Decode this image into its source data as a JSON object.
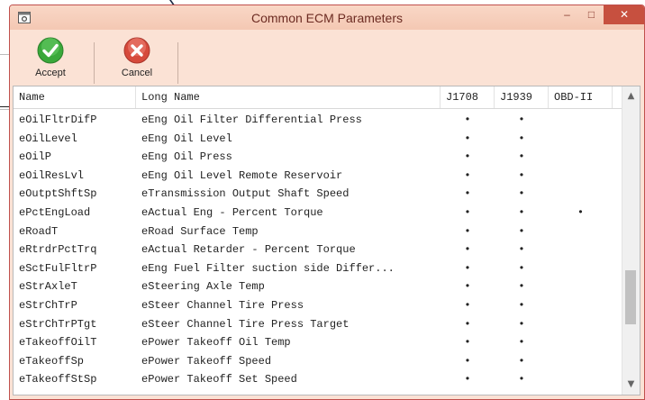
{
  "window": {
    "title": "Common ECM Parameters"
  },
  "controls": {
    "minimize": "–",
    "maximize": "□",
    "close": "✕"
  },
  "toolbar": {
    "accept_label": "Accept",
    "cancel_label": "Cancel"
  },
  "icons": {
    "app": "window-settings-icon",
    "accept": "green-checkmark-icon",
    "cancel": "red-x-icon",
    "scroll_up": "chevron-up-icon",
    "scroll_down": "chevron-down-icon"
  },
  "colors": {
    "title_bar": "#f7cfbc",
    "close_button": "#c7503f",
    "accept": "#3aa83a",
    "cancel": "#d64a3c"
  },
  "table": {
    "columns": [
      "Name",
      "Long Name",
      "J1708",
      "J1939",
      "OBD-II"
    ],
    "rows": [
      [
        "eOilFltrDifP",
        "eEng Oil Filter Differential Press",
        "•",
        "•",
        ""
      ],
      [
        "eOilLevel",
        "eEng Oil Level",
        "•",
        "•",
        ""
      ],
      [
        "eOilP",
        "eEng Oil Press",
        "•",
        "•",
        ""
      ],
      [
        "eOilResLvl",
        "eEng Oil Level Remote Reservoir",
        "•",
        "•",
        ""
      ],
      [
        "eOutptShftSp",
        "eTransmission Output Shaft Speed",
        "•",
        "•",
        ""
      ],
      [
        "ePctEngLoad",
        "eActual Eng - Percent Torque",
        "•",
        "•",
        "•"
      ],
      [
        "eRoadT",
        "eRoad Surface Temp",
        "•",
        "•",
        ""
      ],
      [
        "eRtrdrPctTrq",
        "eActual Retarder - Percent Torque",
        "•",
        "•",
        ""
      ],
      [
        "eSctFulFltrP",
        "eEng Fuel Filter suction side Differ...",
        "•",
        "•",
        ""
      ],
      [
        "eStrAxleT",
        "eSteering Axle Temp",
        "•",
        "•",
        ""
      ],
      [
        "eStrChTrP",
        "eSteer Channel Tire Press",
        "•",
        "•",
        ""
      ],
      [
        "eStrChTrPTgt",
        "eSteer Channel Tire Press Target",
        "•",
        "•",
        ""
      ],
      [
        "eTakeoffOilT",
        "ePower Takeoff Oil Temp",
        "•",
        "•",
        ""
      ],
      [
        "eTakeoffSp",
        "ePower Takeoff Speed",
        "•",
        "•",
        ""
      ],
      [
        "eTakeoffStSp",
        "ePower Takeoff Set Speed",
        "•",
        "•",
        ""
      ]
    ]
  }
}
